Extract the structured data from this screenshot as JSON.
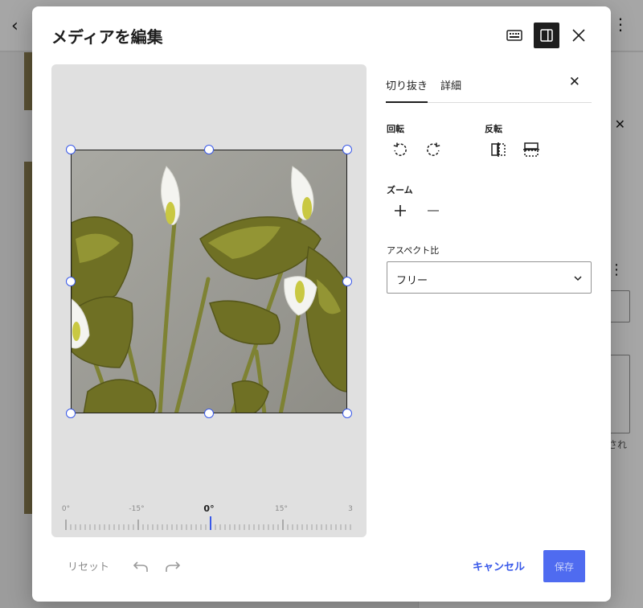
{
  "modal": {
    "title": "メディアを編集",
    "header_icons": {
      "keyboard": "keyboard-icon",
      "panel": "sidebar-toggle-icon",
      "close": "close-icon"
    }
  },
  "tabs": [
    {
      "label": "切り抜き",
      "active": true
    },
    {
      "label": "詳細",
      "active": false
    }
  ],
  "rotate": {
    "label": "回転",
    "icons": [
      "rotate-left-icon",
      "rotate-right-icon"
    ]
  },
  "flip": {
    "label": "反転",
    "icons": [
      "flip-horizontal-icon",
      "flip-vertical-icon"
    ]
  },
  "zoom": {
    "label": "ズーム",
    "icons": [
      "zoom-in-icon",
      "zoom-out-icon"
    ]
  },
  "aspect": {
    "label": "アスペクト比",
    "value": "フリー"
  },
  "ruler": {
    "labels": [
      "-15°",
      "0°",
      "15°"
    ],
    "edge_left": "0°",
    "edge_right": "3",
    "value": 0
  },
  "footer": {
    "reset": "リセット",
    "cancel": "キャンセル",
    "save": "保存"
  },
  "background": {
    "sidebar_text": "され"
  },
  "colors": {
    "accent": "#3858e9",
    "save_bg": "#4f6bf0",
    "dark": "#1e1e1e"
  }
}
